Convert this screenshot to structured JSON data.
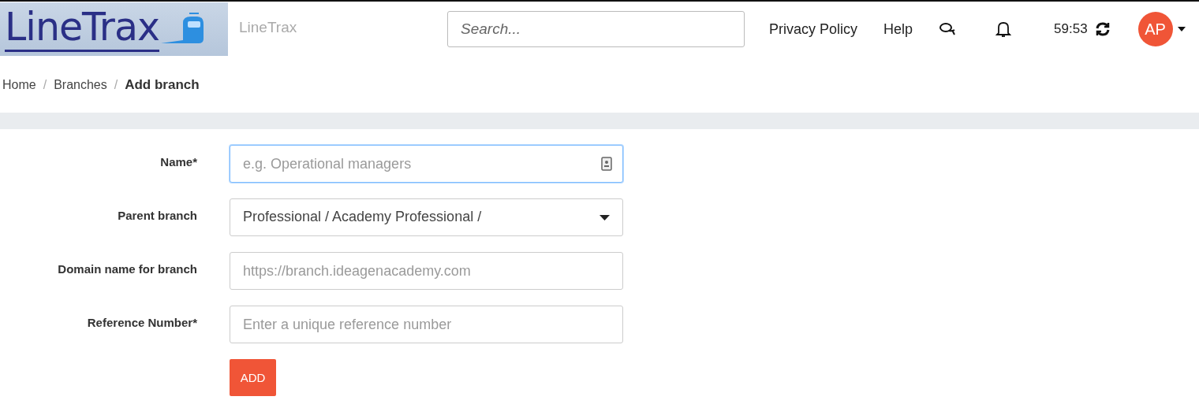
{
  "header": {
    "logo_text": "LineTrax",
    "app_name": "LineTrax",
    "search": {
      "placeholder": "Search..."
    },
    "links": [
      "Privacy Policy",
      "Help"
    ],
    "timer": "59:53",
    "avatar": "AP"
  },
  "breadcrumb": [
    {
      "label": "Home",
      "current": false,
      "separator": "/"
    },
    {
      "label": "Branches",
      "current": false,
      "separator": "/"
    },
    {
      "label": "Add branch",
      "current": true
    }
  ],
  "form": {
    "fields": [
      {
        "label": "Name*",
        "kind": "text_icon",
        "placeholder": "e.g. Operational managers",
        "focused": true
      },
      {
        "label": "Parent branch",
        "kind": "select",
        "value": "Professional / Academy Professional /",
        "focused": false
      },
      {
        "label": "Domain name for branch",
        "kind": "text",
        "placeholder": "https://branch.ideagenacademy.com",
        "focused": false
      },
      {
        "label": "Reference Number*",
        "kind": "text",
        "placeholder": "Enter a unique reference number",
        "focused": false
      }
    ],
    "submit": "ADD"
  }
}
